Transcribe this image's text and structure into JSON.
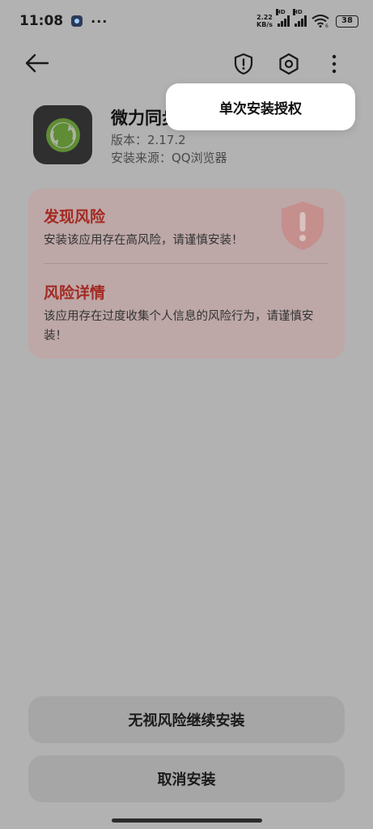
{
  "status_bar": {
    "time": "11:08",
    "more": "···",
    "net_speed_value": "2.22",
    "net_speed_unit": "KB/s",
    "hd1": "HD",
    "hd2": "HD",
    "wifi_sub": "6",
    "battery": "38"
  },
  "toolbar": {
    "back_icon": "arrow-left-icon",
    "shield_icon": "shield-alert-icon",
    "settings_icon": "hexagon-gear-icon",
    "more_icon": "vertical-dots-icon"
  },
  "popup_menu": {
    "item": "单次安装授权"
  },
  "app": {
    "name": "微力同步",
    "version": "版本：2.17.2",
    "source": "安装来源：QQ浏览器",
    "icon": "sync-circle-icon"
  },
  "risk": {
    "found_title": "发现风险",
    "found_desc": "安装该应用存在高风险，请谨慎安装！",
    "detail_title": "风险详情",
    "detail_desc": "该应用存在过度收集个人信息的风险行为，请谨慎安装！",
    "badge_icon": "warning-shield-icon"
  },
  "actions": {
    "continue_label": "无视风险继续安装",
    "cancel_label": "取消安装"
  },
  "colors": {
    "overlay_bg": "#b2b2b2",
    "risk_red": "#a32a22",
    "risk_card_bg": "#bda7a7",
    "button_bg": "#a6a6a6",
    "popup_bg": "#ffffff"
  }
}
